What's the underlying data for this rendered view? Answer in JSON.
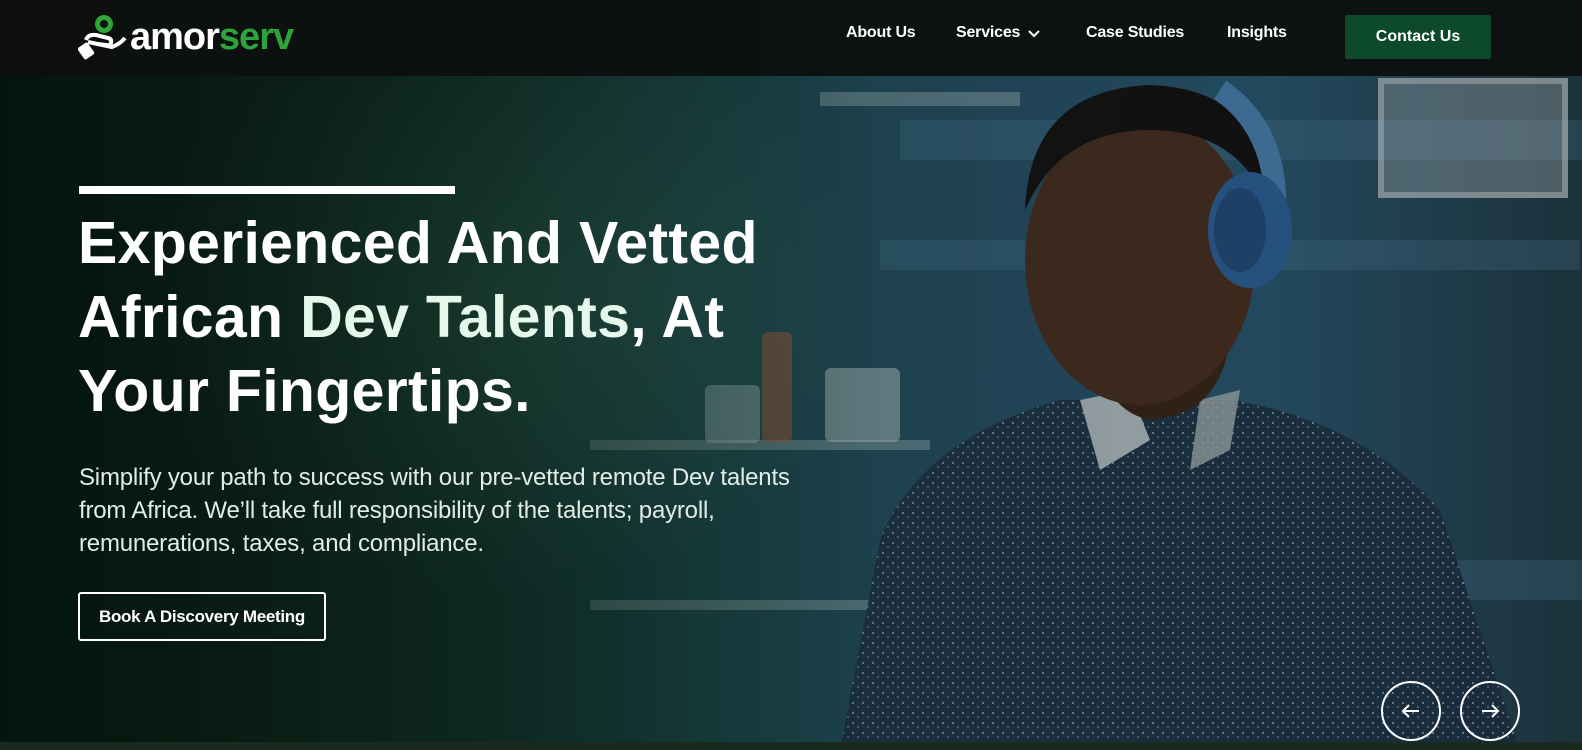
{
  "header": {
    "logo": {
      "part1": "amor",
      "part2": "serv"
    },
    "nav": [
      {
        "label": "About Us"
      },
      {
        "label": "Services",
        "has_dropdown": true
      },
      {
        "label": "Case Studies"
      },
      {
        "label": "Insights"
      }
    ],
    "contact_label": "Contact Us"
  },
  "hero": {
    "headline_line1": "Experienced And Vetted",
    "headline_line2a": "African ",
    "headline_line2b": "Dev Talents",
    "headline_line2c": ", At",
    "headline_line3": "Your Fingertips.",
    "subtext": "Simplify your path to success with our pre-vetted remote Dev talents from Africa. We’ll take full responsibility of the talents; payroll, remunerations, taxes, and compliance.",
    "cta_label": "Book A Discovery Meeting"
  },
  "carousel": {
    "prev_icon": "arrow-left-icon",
    "next_icon": "arrow-right-icon"
  },
  "colors": {
    "brand_green": "#2fa33a",
    "button_green": "#0d4a2c",
    "header_bg": "#0c100f"
  }
}
